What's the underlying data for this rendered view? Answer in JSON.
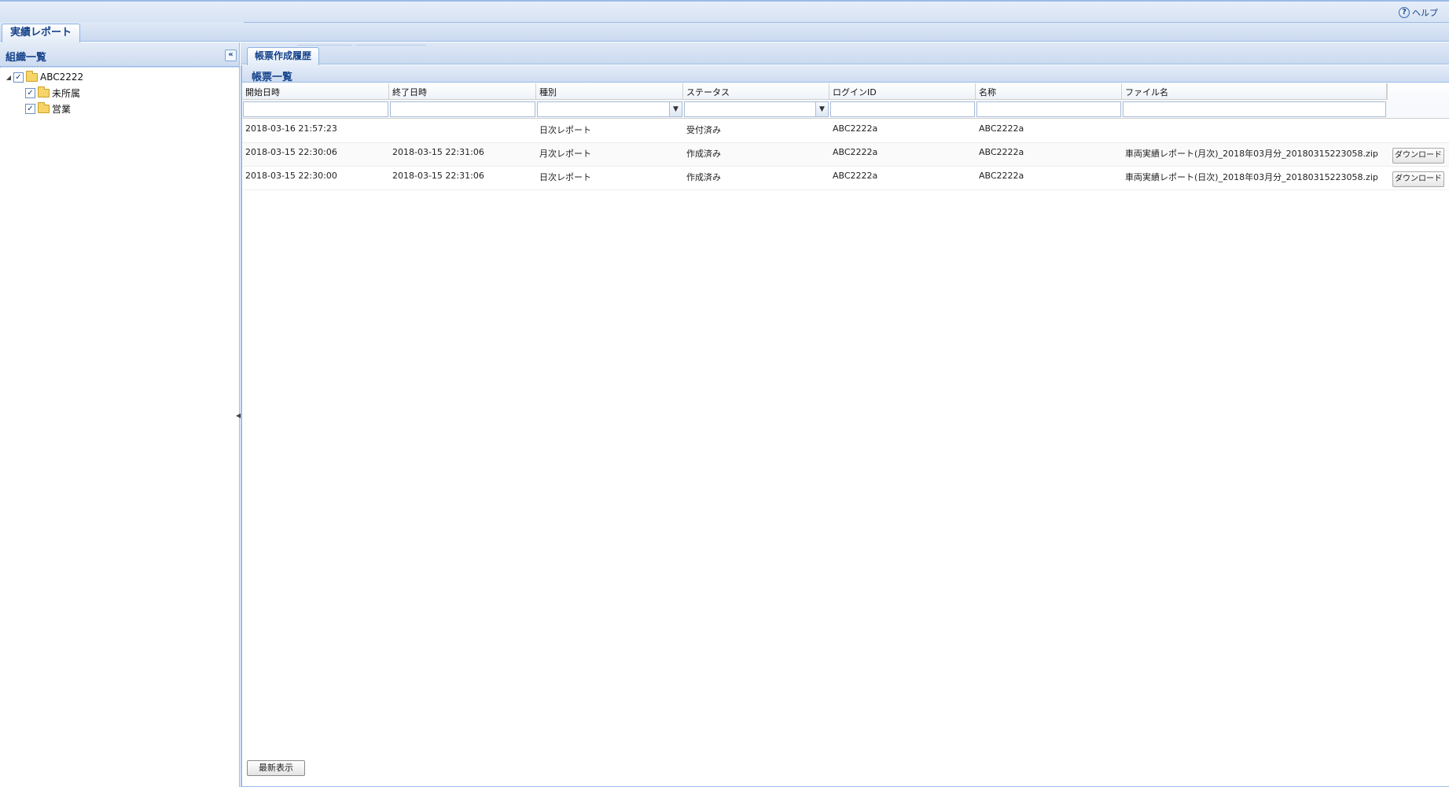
{
  "header": {
    "help_label": "ヘルプ",
    "help_icon": "help-question-icon"
  },
  "main_tab": {
    "label": "実績レポート"
  },
  "left_panel": {
    "title": "組織一覧",
    "collapse_icon": "double-chevron-left-icon",
    "tree": [
      {
        "label": "ABC2222",
        "checked": true,
        "expanded": true,
        "level": 0
      },
      {
        "label": "未所属",
        "checked": true,
        "level": 1
      },
      {
        "label": "営業",
        "checked": true,
        "level": 1
      }
    ]
  },
  "sub_tab": {
    "label": "帳票作成履歴"
  },
  "grid": {
    "title": "帳票一覧",
    "columns": [
      "開始日時",
      "終了日時",
      "種別",
      "ステータス",
      "ログインID",
      "名称",
      "ファイル名"
    ],
    "rows": [
      {
        "start": "2018-03-16 21:57:23",
        "end": "",
        "type": "日次レポート",
        "status": "受付済み",
        "login_id": "ABC2222a",
        "name": "ABC2222a",
        "file": "",
        "download": ""
      },
      {
        "start": "2018-03-15 22:30:06",
        "end": "2018-03-15 22:31:06",
        "type": "月次レポート",
        "status": "作成済み",
        "login_id": "ABC2222a",
        "name": "ABC2222a",
        "file": "車両実績レポート(月次)_2018年03月分_20180315223058.zip",
        "download": "ダウンロード"
      },
      {
        "start": "2018-03-15 22:30:00",
        "end": "2018-03-15 22:31:06",
        "type": "日次レポート",
        "status": "作成済み",
        "login_id": "ABC2222a",
        "name": "ABC2222a",
        "file": "車両実績レポート(日次)_2018年03月分_20180315223058.zip",
        "download": "ダウンロード"
      }
    ]
  },
  "footer": {
    "refresh_label": "最新表示"
  },
  "colors": {
    "accent": "#15428b",
    "border": "#99bbe8",
    "header_bg": "#dfe8f6"
  }
}
